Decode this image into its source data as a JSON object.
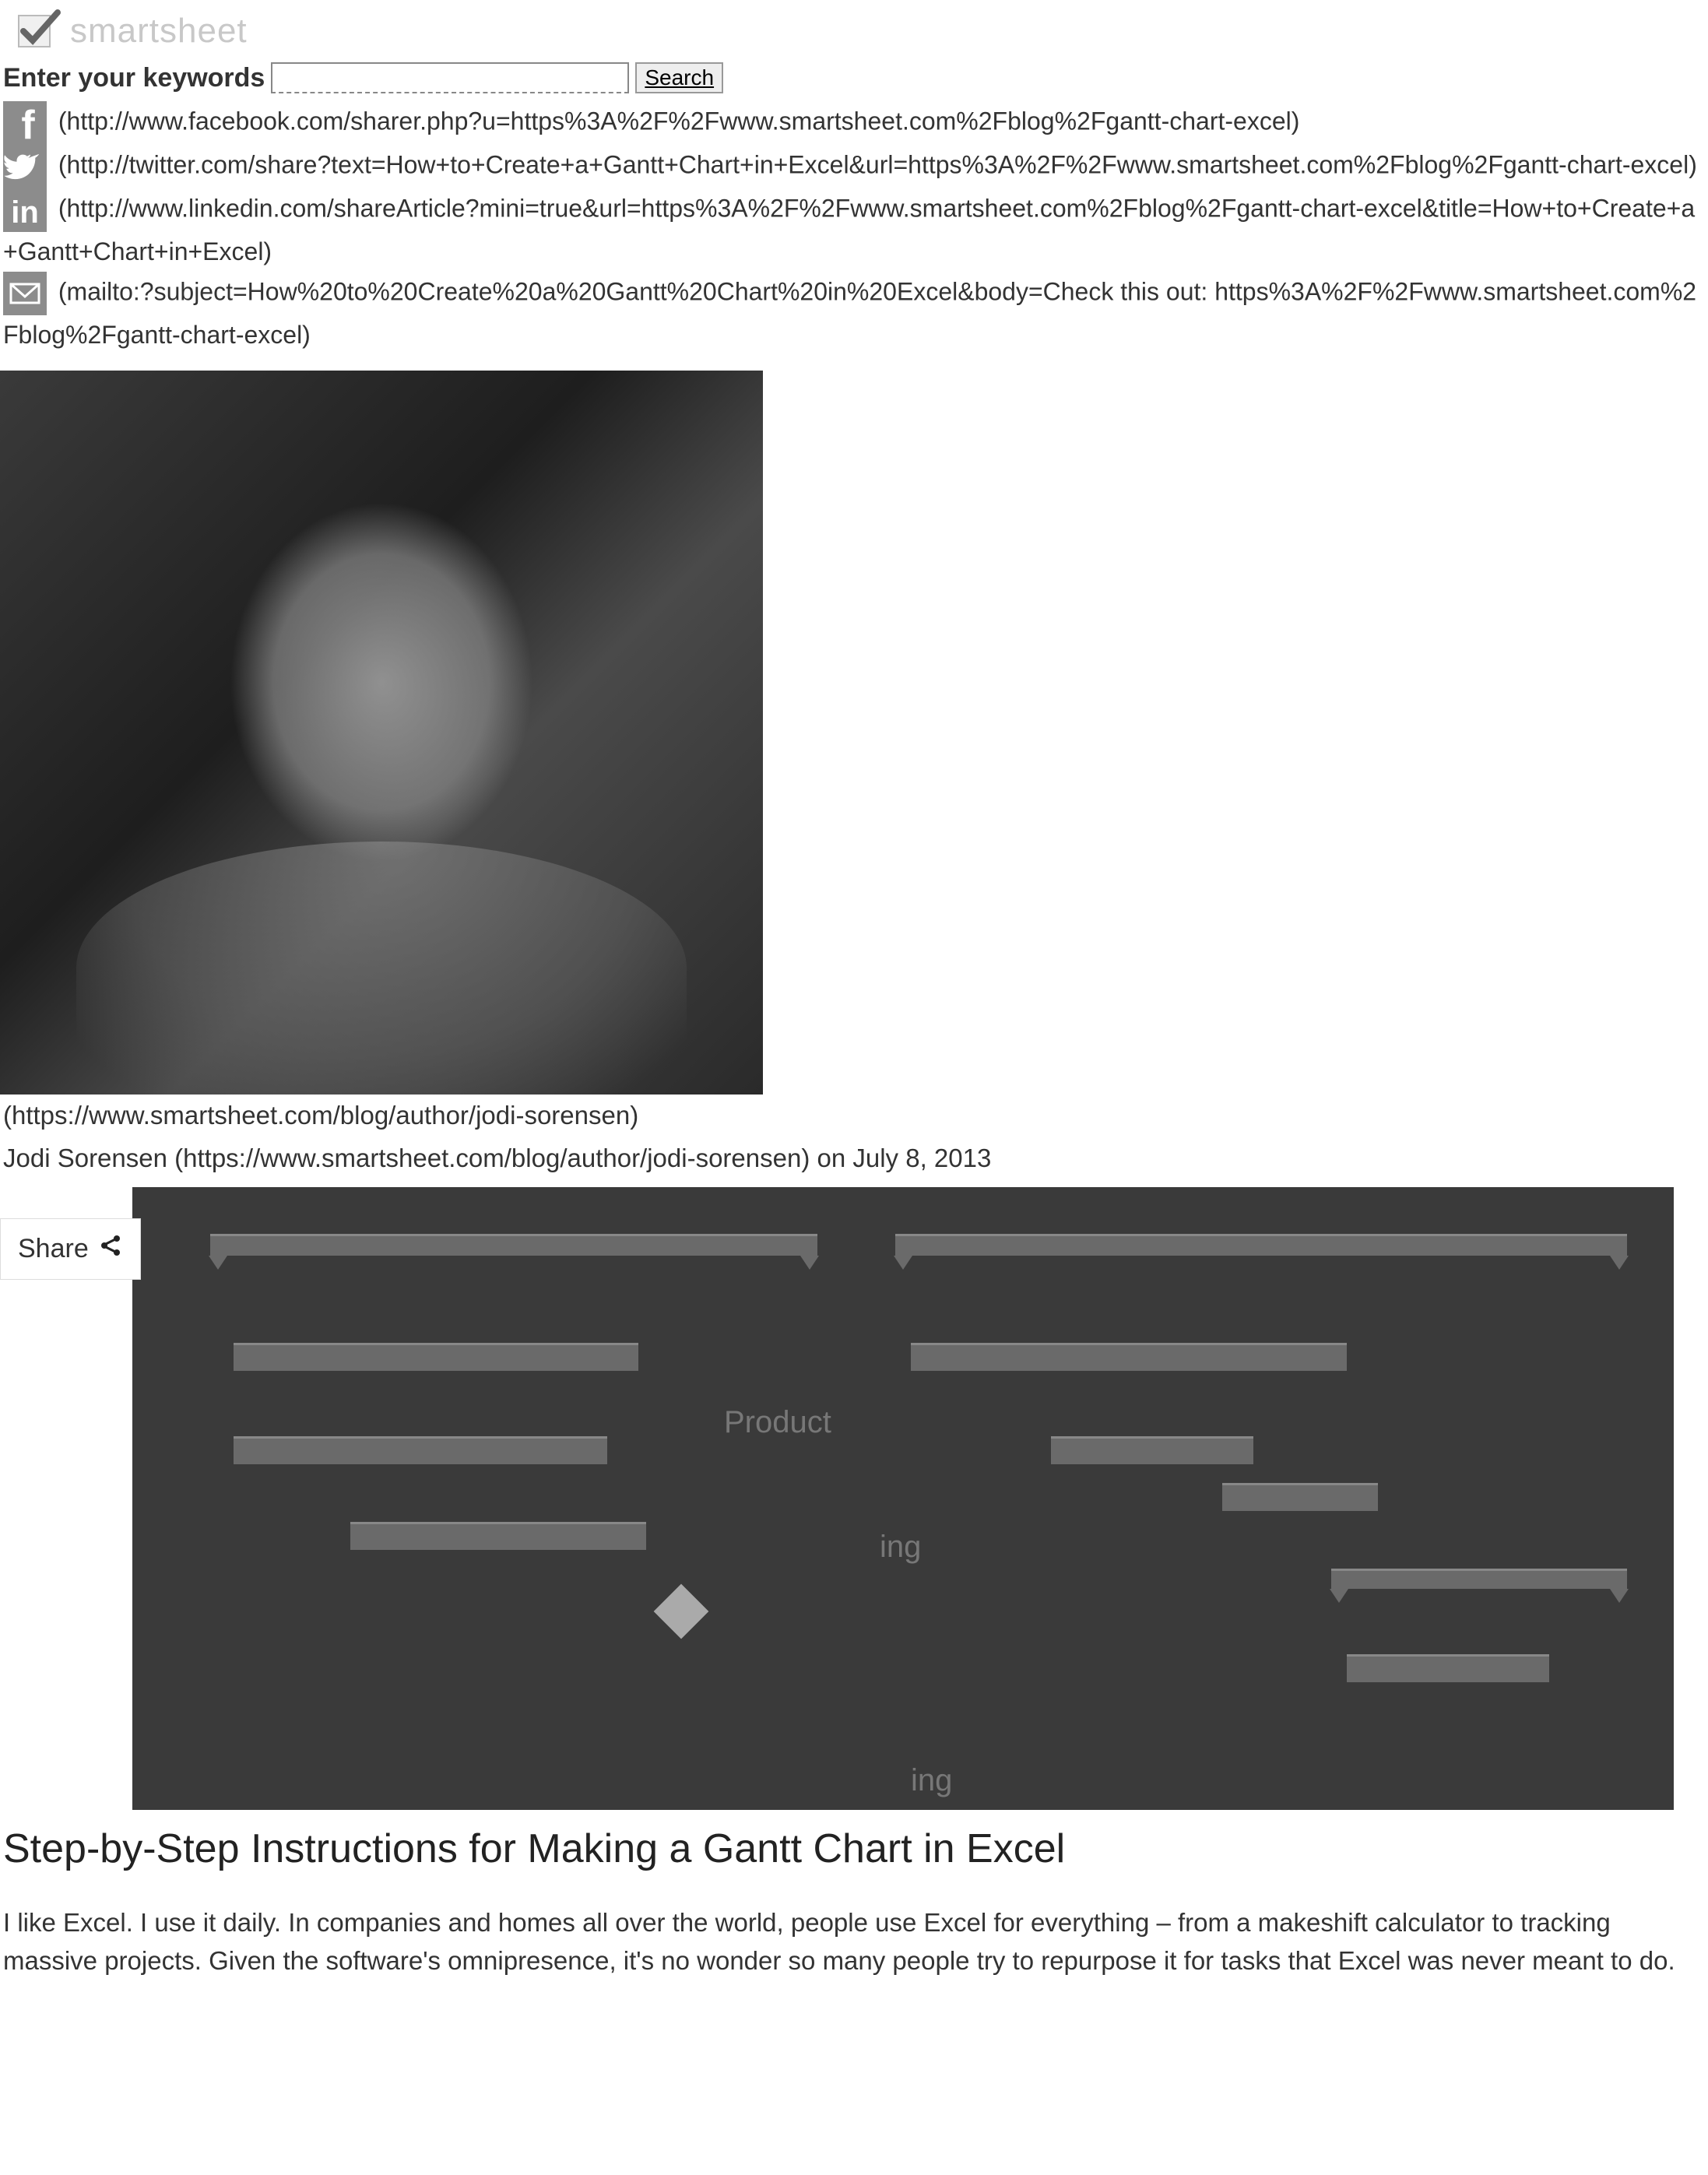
{
  "logo": {
    "brand_text": "smartsheet"
  },
  "search": {
    "label": "Enter your keywords",
    "button": "Search"
  },
  "share_links": {
    "facebook": "(http://www.facebook.com/sharer.php?u=https%3A%2F%2Fwww.smartsheet.com%2Fblog%2Fgantt-chart-excel)",
    "twitter": "(http://twitter.com/share?text=How+to+Create+a+Gantt+Chart+in+Excel&url=https%3A%2F%2Fwww.smartsheet.com%2Fblog%2Fgantt-chart-excel)",
    "linkedin": "(http://www.linkedin.com/shareArticle?mini=true&url=https%3A%2F%2Fwww.smartsheet.com%2Fblog%2Fgantt-chart-excel&title=How+to+Create+a+Gantt+Chart+in+Excel)",
    "email": "(mailto:?subject=How%20to%20Create%20a%20Gantt%20Chart%20in%20Excel&body=Check this out: https%3A%2F%2Fwww.smartsheet.com%2Fblog%2Fgantt-chart-excel)"
  },
  "author": {
    "profile_url": "(https://www.smartsheet.com/blog/author/jodi-sorensen)",
    "byline": "Jodi Sorensen (https://www.smartsheet.com/blog/author/jodi-sorensen) on July 8, 2013"
  },
  "share_tab": {
    "label": "Share"
  },
  "hero": {
    "text_product": "Product",
    "text_ing1": "ing",
    "text_ing2": "ing"
  },
  "article": {
    "heading": "Step-by-Step Instructions for Making a Gantt Chart in Excel",
    "paragraph1": "I like Excel. I use it daily. In companies and homes all over the world, people use Excel for everything – from a makeshift calculator to tracking massive projects. Given the software's omnipresence, it's no wonder so many people try to repurpose it for tasks that Excel was never meant to do."
  }
}
